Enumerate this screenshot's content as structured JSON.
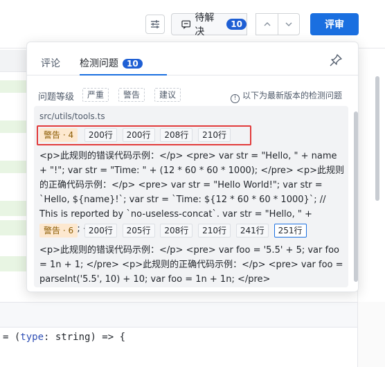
{
  "toolbar": {
    "pending_label": "待解决",
    "pending_count": "10",
    "review_label": "评审"
  },
  "tabs": {
    "comments_label": "评论",
    "issues_label": "检测问题",
    "issues_count": "10"
  },
  "filter": {
    "level_label": "问题等级",
    "levels": [
      "严重",
      "警告",
      "建议"
    ],
    "info_text": "以下为最新版本的检测问题"
  },
  "file": {
    "path": "src/utils/tools.ts"
  },
  "issues": [
    {
      "severity": "警告 · 4",
      "lines": [
        "200行",
        "200行",
        "208行",
        "210行"
      ],
      "description": "<p>此规则的错误代码示例：</p> <pre> var str = \"Hello, \" + name + \"!\"; var str = \"Time: \" + (12 * 60 * 60 * 1000); </pre> <p>此规则的正确代码示例：</p> <pre> var str = \"Hello World!\"; var str = `Hello, ${name}!`; var str = `Time: ${12 * 60 * 60 * 1000}`; // This is reported by `no-useless-concat`. var str = \"Hello, \" + \"World!\"; </pre>"
    },
    {
      "severity": "警告 · 6",
      "lines": [
        "200行",
        "205行",
        "208行",
        "210行",
        "241行",
        "251行"
      ],
      "description": "<p>此规则的错误代码示例：</p> <pre> var foo = '5.5' + 5; var foo = 1n + 1; </pre> <p>此规则的正确代码示例：</p> <pre> var foo = parseInt('5.5', 10) + 10; var foo = 1n + 1n; </pre>"
    }
  ],
  "code": {
    "line_prefix": "= (",
    "param": "type",
    "line_suffix": ": string) => {"
  },
  "colors": {
    "accent": "#1a6fe0",
    "badge": "#1e5fd4",
    "warning_bg": "#fde8cf",
    "highlight": "#e23a3a"
  }
}
